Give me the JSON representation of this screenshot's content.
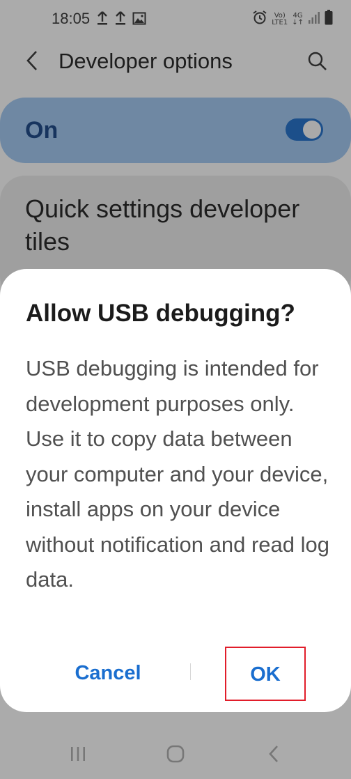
{
  "status_bar": {
    "time": "18:05",
    "icons_left": [
      "upload-icon",
      "upload-icon",
      "image-icon"
    ],
    "icons_right": [
      "alarm-icon",
      "volte-icon",
      "4g-lte-icon",
      "signal-icon",
      "battery-icon"
    ],
    "volte_text_top": "Vo)",
    "volte_text_bottom": "LTE1",
    "network_text": "4G"
  },
  "app_bar": {
    "title": "Developer options",
    "back_icon": "chevron-left-icon",
    "search_icon": "search-icon"
  },
  "master_switch": {
    "label": "On",
    "state": "on",
    "accent": "#1c4f8a"
  },
  "tiles_card": {
    "label": "Quick settings developer tiles"
  },
  "dialog": {
    "title": "Allow USB debugging?",
    "body": "USB debugging is intended for development purposes only. Use it to copy data between your computer and your device, install apps on your device without notification and read log data.",
    "cancel_label": "Cancel",
    "ok_label": "OK",
    "button_color": "#1a6ecf",
    "highlight_color": "#e11d2a"
  },
  "nav_bar": {
    "recents_icon": "recents-icon",
    "home_icon": "home-icon",
    "back_icon": "back-icon"
  }
}
